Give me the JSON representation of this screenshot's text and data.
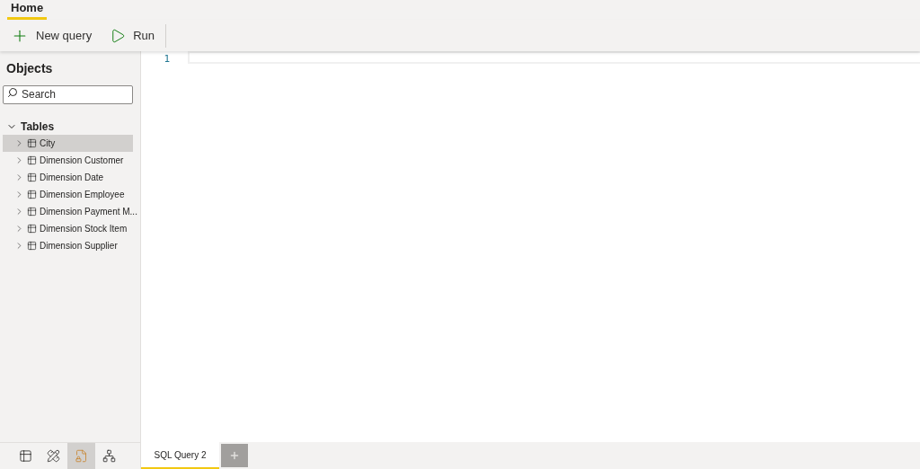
{
  "ribbon": {
    "tabs": [
      {
        "label": "Home",
        "selected": true
      }
    ],
    "buttons": [
      {
        "kind": "new",
        "label": "New query"
      },
      {
        "kind": "run",
        "label": "Run"
      }
    ]
  },
  "objects": {
    "title": "Objects",
    "search": {
      "placeholder": "Search"
    },
    "tree": [
      {
        "label": "Tables",
        "expanded": true,
        "children": [
          {
            "label": "City",
            "selected": true,
            "expanded": false
          },
          {
            "label": "Dimension Customer",
            "selected": false,
            "expanded": false
          },
          {
            "label": "Dimension Date",
            "selected": false,
            "expanded": false
          },
          {
            "label": "Dimension Employee",
            "selected": false,
            "expanded": false
          },
          {
            "label": "Dimension Payment M...",
            "selected": false,
            "expanded": false
          },
          {
            "label": "Dimension Stock Item",
            "selected": false,
            "expanded": false
          },
          {
            "label": "Dimension Supplier",
            "selected": false,
            "expanded": false
          }
        ]
      }
    ]
  },
  "view_switcher": [
    {
      "kind": "data",
      "selected": false
    },
    {
      "kind": "model",
      "selected": false
    },
    {
      "kind": "query",
      "selected": true
    },
    {
      "kind": "diagram",
      "selected": false
    }
  ],
  "editor": {
    "line_numbers": [
      "1"
    ]
  },
  "query_tabs": [
    {
      "label": "SQL Query 2",
      "selected": true
    }
  ]
}
